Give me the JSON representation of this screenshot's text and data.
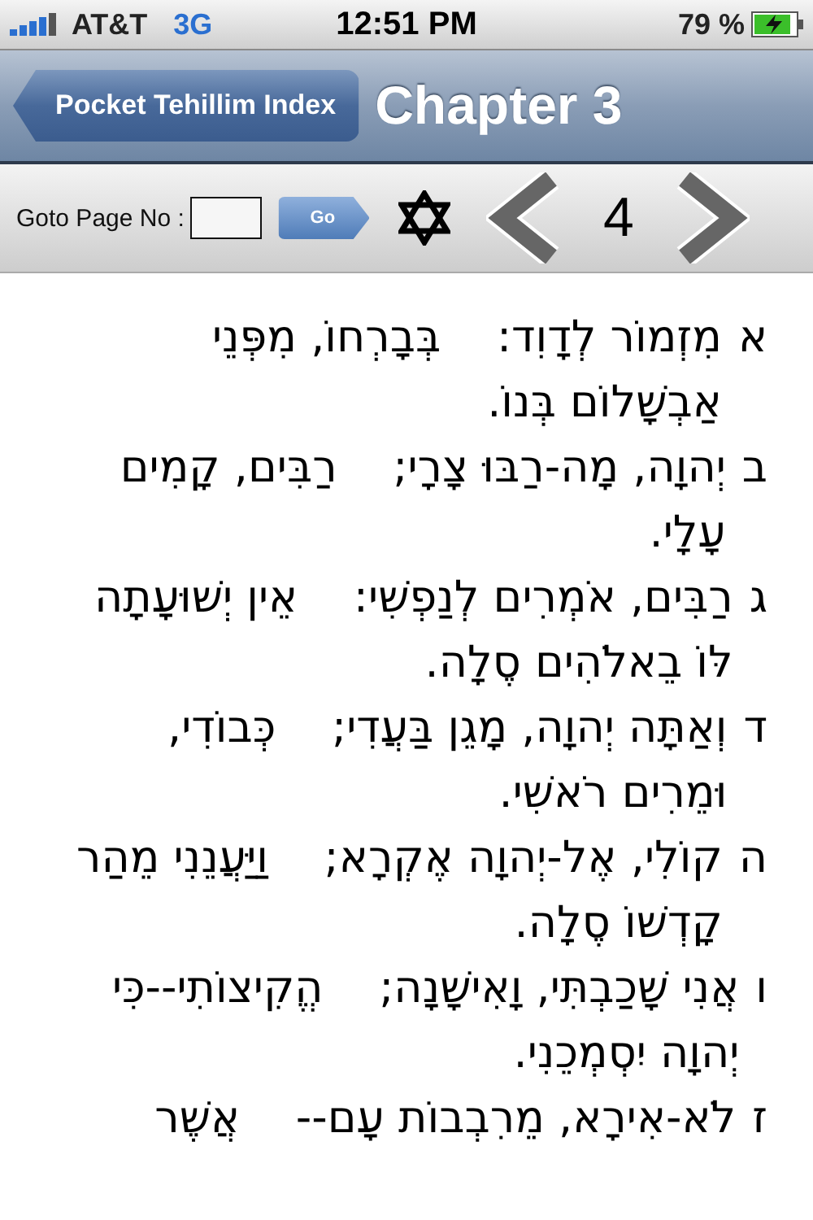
{
  "status_bar": {
    "carrier": "AT&T",
    "network": "3G",
    "time": "12:51 PM",
    "battery": "79 %"
  },
  "nav_bar": {
    "back_button": "Pocket Tehillim Index",
    "title": "Chapter 3"
  },
  "toolbar": {
    "goto_label": "Goto Page No :",
    "go_button": "Go",
    "page_number": "4"
  },
  "verses": [
    {
      "number": "א",
      "lines": [
        "מִזְמוֹר לְדָוִד:    בְּבָרְחוֹ, מִפְּנֵי",
        "אַבְשָׁלוֹם בְּנוֹ."
      ]
    },
    {
      "number": "ב",
      "lines": [
        "יְהוָה, מָה-רַבּוּ צָרָי;    רַבִּים, קָמִים",
        "עָלָי."
      ]
    },
    {
      "number": "ג",
      "lines": [
        "רַבִּים, אֹמְרִים לְנַפְשִׁי:    אֵין יְשׁוּעָתָה",
        "לּוֹ בֵאלֹהִים סֶלָה."
      ]
    },
    {
      "number": "ד",
      "lines": [
        "וְאַתָּה יְהוָה, מָגֵן בַּעֲדִי;    כְּבוֹדִי,",
        "וּמֵרִים רֹאשִׁי."
      ]
    },
    {
      "number": "ה",
      "lines": [
        "קוֹלִי, אֶל-יְהוָה אֶקְרָא;    וַיַּעֲנֵנִי מֵהַר",
        "קָדְשׁוֹ סֶלָה."
      ]
    },
    {
      "number": "ו",
      "lines": [
        "אֲנִי שָׁכַבְתִּי, וָאִישָׁנָה;    הֱקִיצוֹתִי--כִּי",
        "יְהוָה יִסְמְכֵנִי."
      ]
    },
    {
      "number": "ז",
      "lines": [
        "לֹא-אִירָא, מֵרִבְבוֹת עָם--    אֲשֶׁר"
      ]
    }
  ]
}
